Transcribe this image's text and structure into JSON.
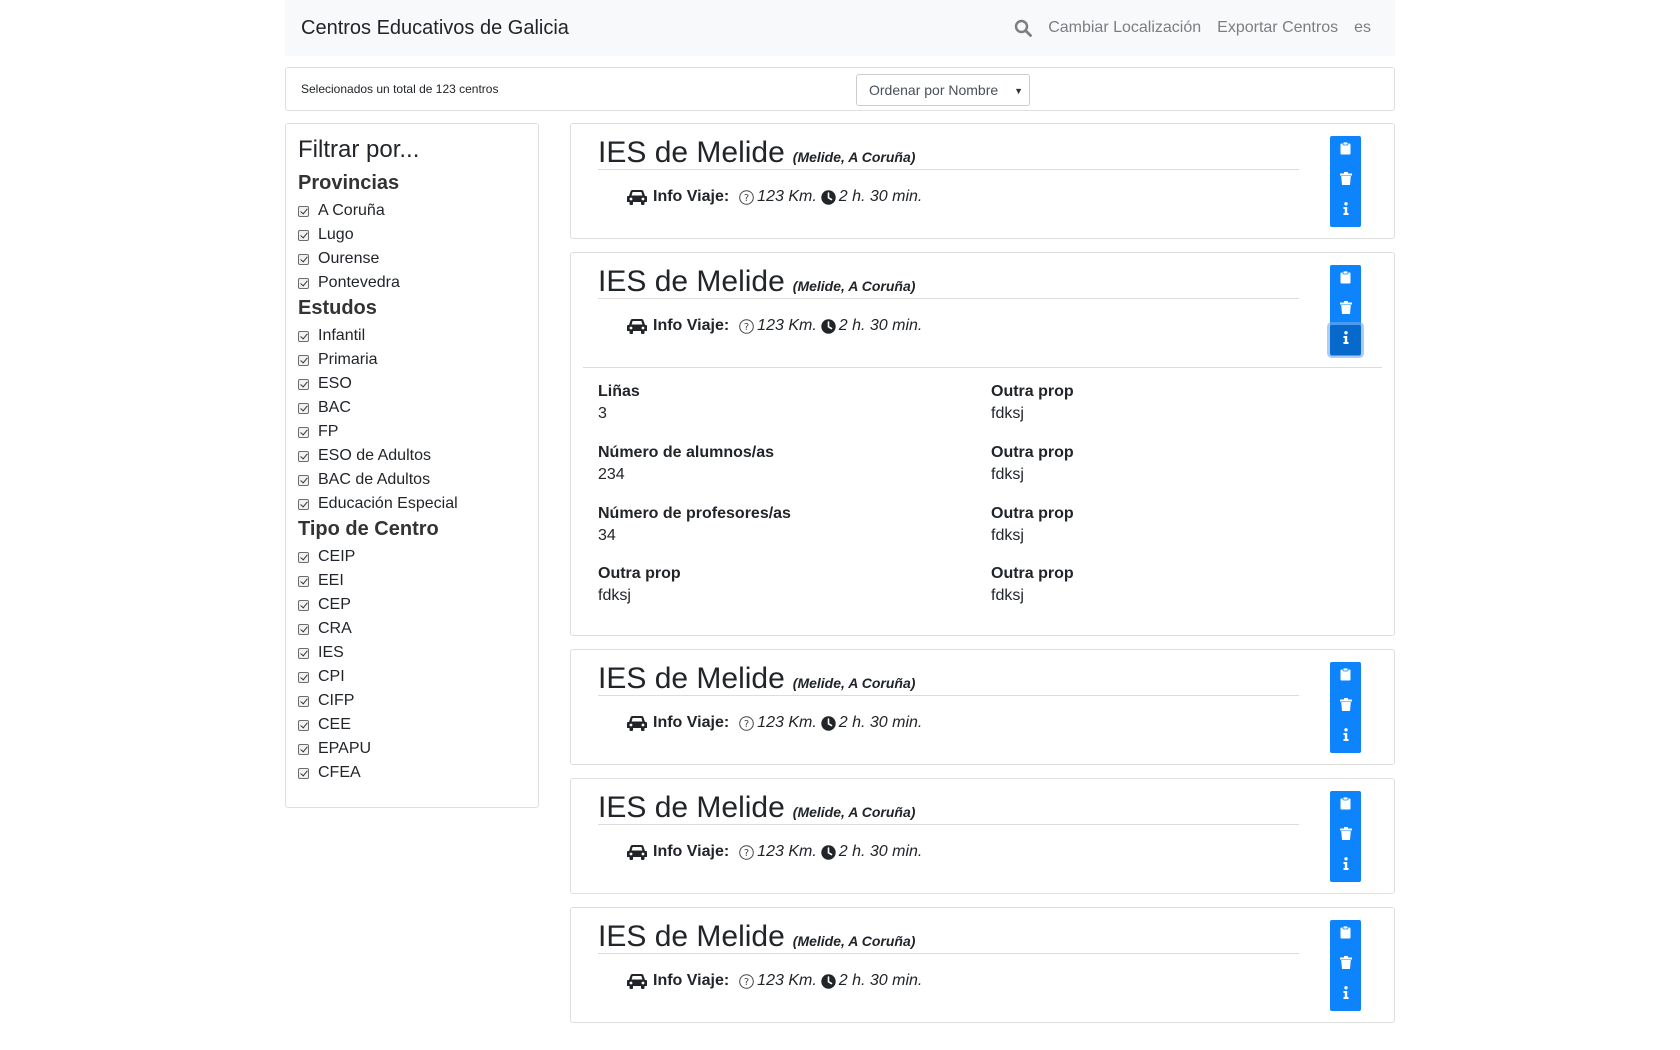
{
  "navbar": {
    "brand": "Centros Educativos de Galicia",
    "search_icon": "search-icon",
    "change_location": "Cambiar Localización",
    "export": "Exportar Centros",
    "lang": "es"
  },
  "toolbar": {
    "total_text": "Selecionados un total de 123 centros",
    "sort_selected": "Ordenar por Nombre"
  },
  "filters": {
    "title": "Filtrar por...",
    "provincias": {
      "heading": "Provincias",
      "items": [
        "A Coruña",
        "Lugo",
        "Ourense",
        "Pontevedra"
      ]
    },
    "estudos": {
      "heading": "Estudos",
      "items": [
        "Infantil",
        "Primaria",
        "ESO",
        "BAC",
        "FP",
        "ESO de Adultos",
        "BAC de Adultos",
        "Educación Especial"
      ]
    },
    "tipo": {
      "heading": "Tipo de Centro",
      "items": [
        "CEIP",
        "EEI",
        "CEP",
        "CRA",
        "IES",
        "CPI",
        "CIFP",
        "CEE",
        "EPAPU",
        "CFEA"
      ]
    }
  },
  "centers": [
    {
      "name": "IES de Melide",
      "location": "(Melide, A Coruña)",
      "travel_label": "Info Viaje:",
      "distance": "123 Km.",
      "time": "2 h. 30 min.",
      "expanded": false
    },
    {
      "name": "IES de Melide",
      "location": "(Melide, A Coruña)",
      "travel_label": "Info Viaje:",
      "distance": "123 Km.",
      "time": "2 h. 30 min.",
      "expanded": true,
      "details": [
        {
          "key": "Liñas",
          "value": "3"
        },
        {
          "key": "Outra prop",
          "value": "fdksj"
        },
        {
          "key": "Número de alumnos/as",
          "value": "234"
        },
        {
          "key": "Outra prop",
          "value": "fdksj"
        },
        {
          "key": "Número de profesores/as",
          "value": "34"
        },
        {
          "key": "Outra prop",
          "value": "fdksj"
        },
        {
          "key": "Outra prop",
          "value": "fdksj"
        },
        {
          "key": "Outra prop",
          "value": "fdksj"
        }
      ]
    },
    {
      "name": "IES de Melide",
      "location": "(Melide, A Coruña)",
      "travel_label": "Info Viaje:",
      "distance": "123 Km.",
      "time": "2 h. 30 min.",
      "expanded": false
    },
    {
      "name": "IES de Melide",
      "location": "(Melide, A Coruña)",
      "travel_label": "Info Viaje:",
      "distance": "123 Km.",
      "time": "2 h. 30 min.",
      "expanded": false
    },
    {
      "name": "IES de Melide",
      "location": "(Melide, A Coruña)",
      "travel_label": "Info Viaje:",
      "distance": "123 Km.",
      "time": "2 h. 30 min.",
      "expanded": false
    }
  ],
  "colors": {
    "accent": "#0d84fb",
    "accent_active": "#0869cc"
  },
  "card_icons": [
    "clipboard-icon",
    "trash-icon",
    "info-icon"
  ]
}
